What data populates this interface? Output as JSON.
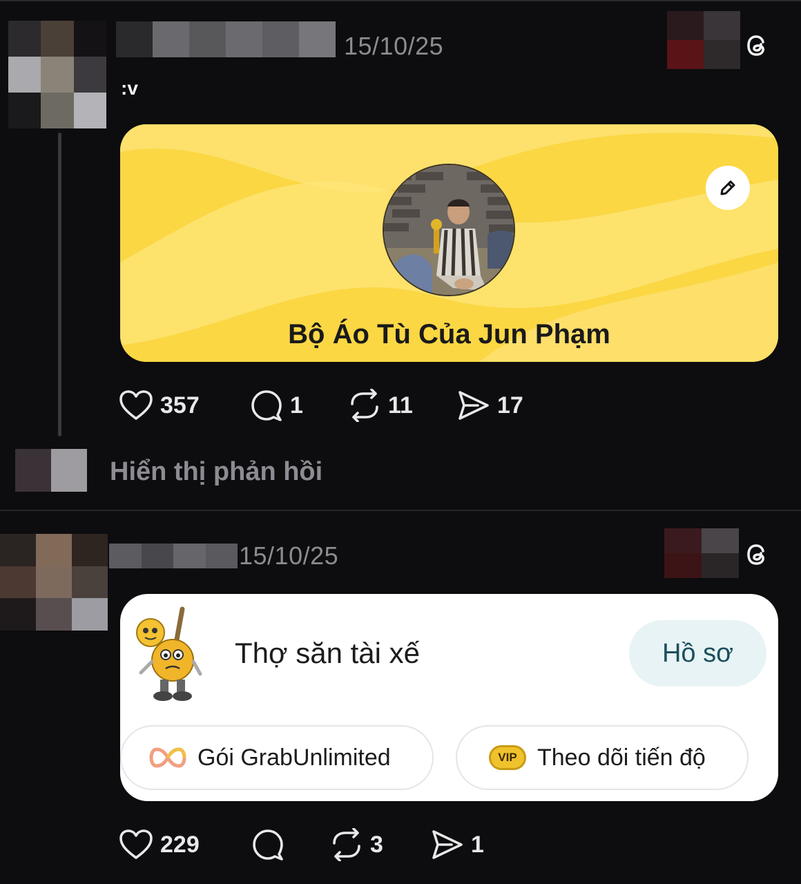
{
  "post1": {
    "date": "15/10/25",
    "caption": ":v",
    "card_title": "Bộ Áo Tù Của Jun Phạm",
    "likes": "357",
    "comments": "1",
    "reposts": "11",
    "shares": "17",
    "show_replies": "Hiển thị phản hồi"
  },
  "post2": {
    "date": "15/10/25",
    "card_title": "Thợ săn tài xế",
    "profile_button": "Hồ sơ",
    "pill_unlimited": "Gói GrabUnlimited",
    "pill_vip_badge": "VIP",
    "pill_progress": "Theo dõi tiến độ",
    "likes": "229",
    "reposts": "3",
    "shares": "1"
  },
  "icons": {
    "like": "heart-icon",
    "comment": "speech-bubble-icon",
    "repost": "repost-icon",
    "share": "send-icon",
    "app": "threads-logo-icon",
    "edit": "pencil-icon"
  },
  "colors": {
    "background": "#0d0c0f",
    "card_yellow": "#fbd744",
    "muted_text": "#8c8b90"
  }
}
